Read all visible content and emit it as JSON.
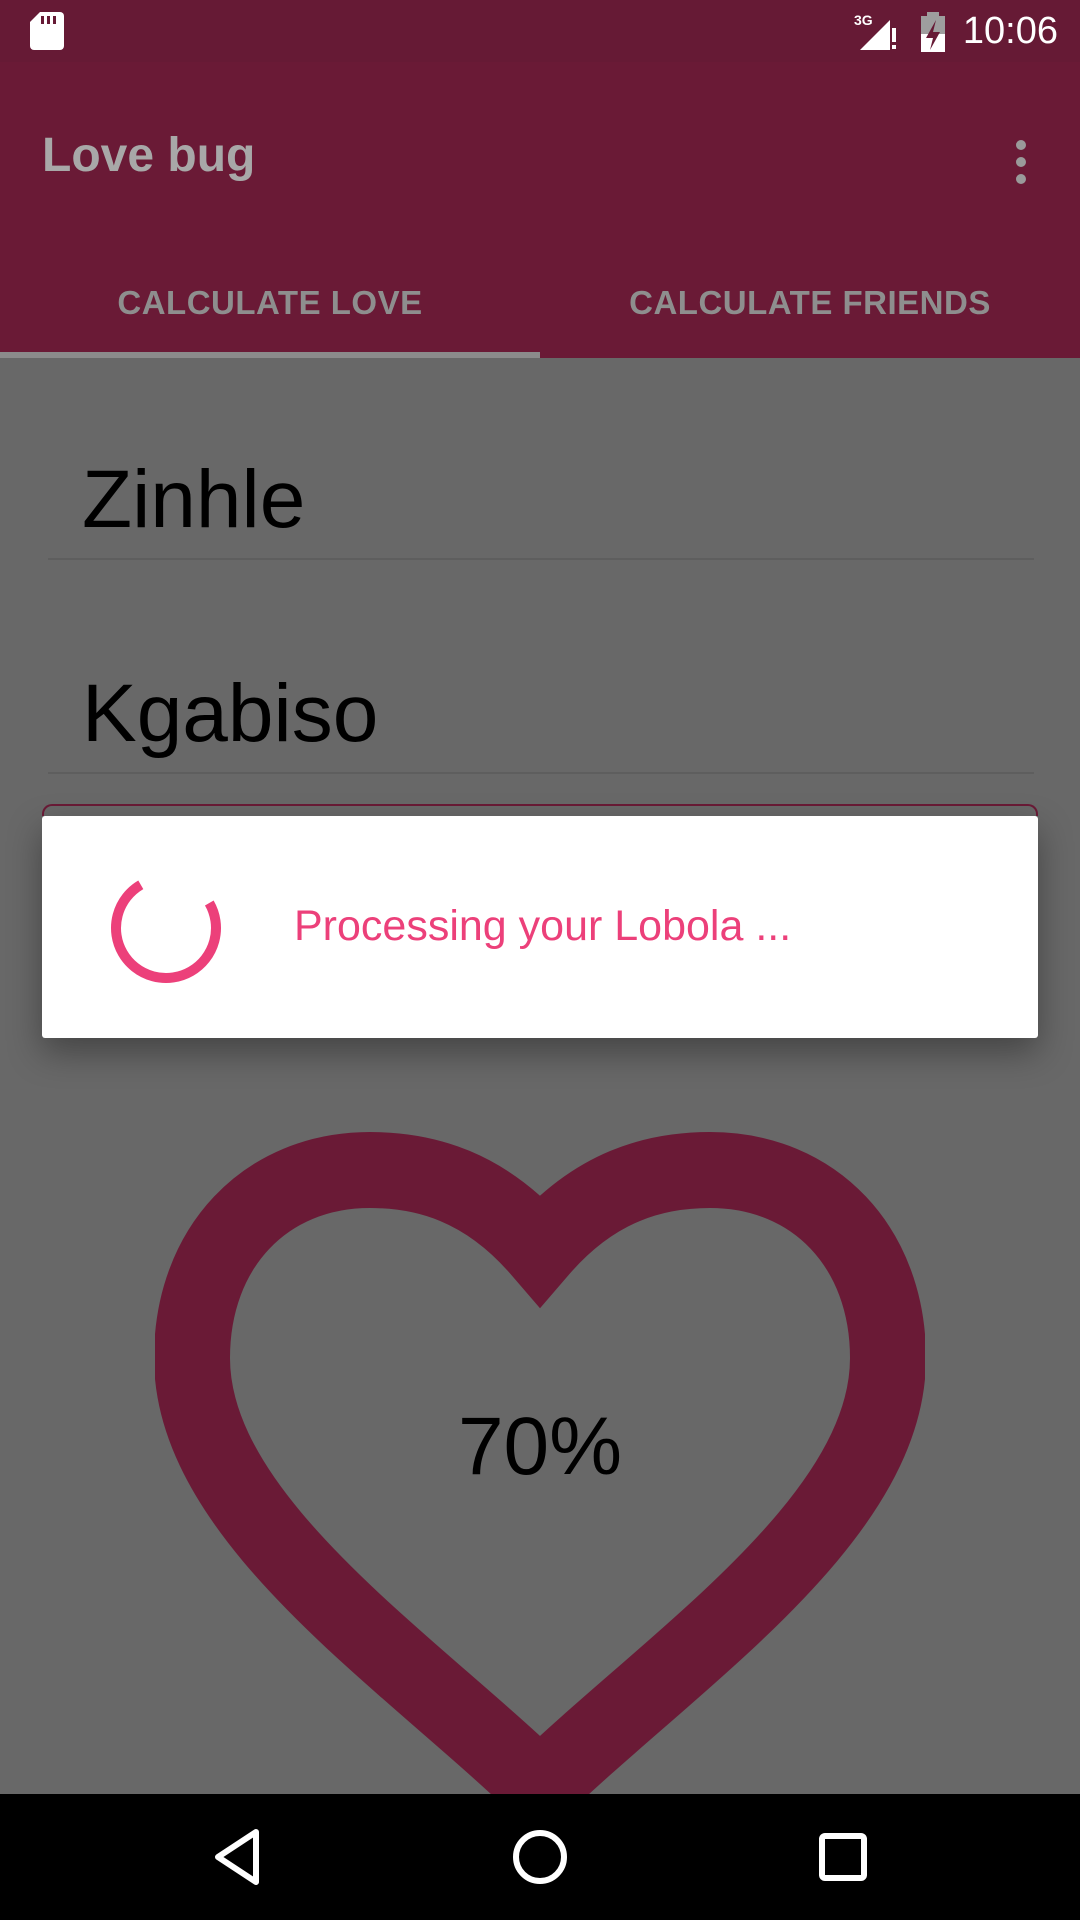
{
  "status_bar": {
    "time": "10:06",
    "network": "3G",
    "icons": [
      "sd-card-icon",
      "signal-icon",
      "battery-icon"
    ]
  },
  "app_bar": {
    "title": "Love bug",
    "menu_icon": "overflow-menu-icon"
  },
  "tabs": [
    {
      "label": "CALCULATE LOVE",
      "selected": true
    },
    {
      "label": "CALCULATE FRIENDS",
      "selected": false
    }
  ],
  "form": {
    "name_one": "Zinhle",
    "name_two": "Kgabiso"
  },
  "result": {
    "percent_text": "70%",
    "heart_icon": "heart-outline-icon"
  },
  "dialog": {
    "message": "Processing your Lobola ...",
    "spinner_icon": "progress-spinner-icon"
  },
  "nav_bar": {
    "buttons": [
      "back-icon",
      "home-icon",
      "recents-icon"
    ]
  },
  "colors": {
    "primary": "#6a1a36",
    "accent": "#ec407a",
    "scrim": "#686868"
  }
}
